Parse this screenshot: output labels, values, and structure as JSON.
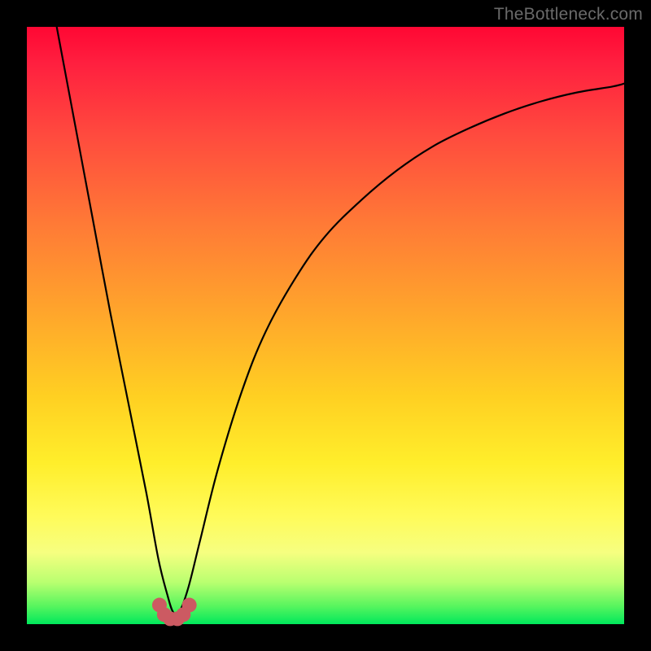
{
  "watermark": "TheBottleneck.com",
  "chart_data": {
    "type": "line",
    "title": "",
    "xlabel": "",
    "ylabel": "",
    "xlim": [
      0,
      100
    ],
    "ylim": [
      0,
      100
    ],
    "grid": false,
    "legend": false,
    "series": [
      {
        "name": "curve",
        "x": [
          5,
          8,
          11,
          14,
          17,
          20,
          22,
          23.5,
          24.5,
          25.5,
          27,
          29,
          32,
          36,
          40,
          45,
          50,
          56,
          62,
          68,
          74,
          80,
          86,
          92,
          98,
          100
        ],
        "y": [
          100,
          84,
          68,
          52,
          37,
          22,
          11,
          5,
          2,
          2,
          6,
          14,
          26,
          39,
          49,
          58,
          65,
          71,
          76,
          80,
          83,
          85.5,
          87.5,
          89,
          90,
          90.5
        ]
      }
    ],
    "marker_cluster": {
      "name": "bottom-nodes",
      "color": "#cc5a62",
      "points": [
        {
          "x": 22.2,
          "y": 3.2
        },
        {
          "x": 23.0,
          "y": 1.6
        },
        {
          "x": 24.0,
          "y": 0.9
        },
        {
          "x": 25.2,
          "y": 0.9
        },
        {
          "x": 26.2,
          "y": 1.6
        },
        {
          "x": 27.2,
          "y": 3.2
        }
      ]
    },
    "gradient_stops": [
      {
        "pos": 0,
        "color": "#ff0733"
      },
      {
        "pos": 18,
        "color": "#ff4a3e"
      },
      {
        "pos": 47,
        "color": "#ffa32c"
      },
      {
        "pos": 73,
        "color": "#ffee2b"
      },
      {
        "pos": 93,
        "color": "#b9ff70"
      },
      {
        "pos": 100,
        "color": "#00e85c"
      }
    ]
  }
}
